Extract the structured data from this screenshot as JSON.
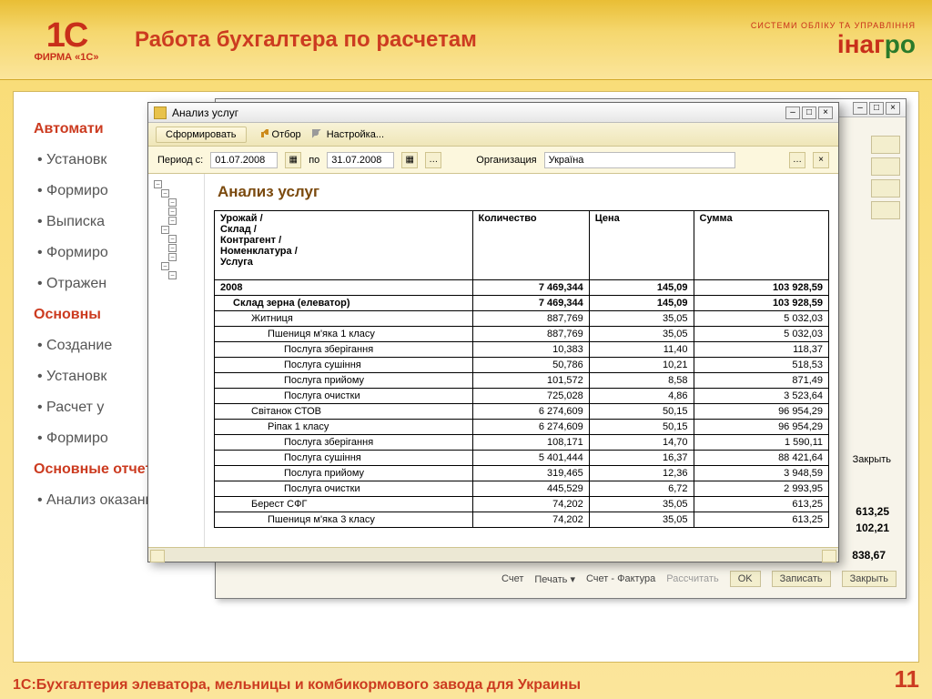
{
  "slide": {
    "logo1c_big": "1C",
    "logo1c_small": "ФИРМА «1С»",
    "title": "Работа бухгалтера по расчетам",
    "inagro_top": "СИСТЕМИ ОБЛІКУ ТА УПРАВЛІННЯ",
    "inagro_red": "інаг",
    "inagro_green": "ро",
    "sec1": "Автомати",
    "bullets1": [
      "Установк",
      "Формиро",
      "Выписка",
      "Формиро",
      "Отражен"
    ],
    "sec2": "Основны",
    "bullets2": [
      "Создание",
      "Установк",
      "Расчет у",
      "Формиро"
    ],
    "sec3": "Основные отчеты:",
    "bullets3": [
      "Анализ оказанных услуг"
    ],
    "footer": "1С:Бухгалтерия элеватора, мельницы и комбикормового завода для Украины",
    "page": "11"
  },
  "bg_window": {
    "v1": "613,25",
    "v2": "102,21",
    "sum": "838,67",
    "btns": [
      "Счет",
      "Печать ▾",
      "Счет - Фактура",
      "Рассчитать",
      "OK",
      "Записать",
      "Закрыть"
    ],
    "close": "Закрыть",
    "save": "ть"
  },
  "an": {
    "title": "Анализ услуг",
    "tb_form": "Сформировать",
    "tb_filter": "Отбор",
    "tb_settings": "Настройка...",
    "p_from_lbl": "Период с:",
    "p_from": "01.07.2008",
    "p_to_lbl": "по",
    "p_to": "31.07.2008",
    "org_lbl": "Организация",
    "org_val": "Україна",
    "rep_title": "Анализ услуг",
    "col_left": "Урожай /\nСклад /\nКонтрагент /\nНоменклатура /\nУслуга",
    "col_qty": "Количество",
    "col_price": "Цена",
    "col_sum": "Сумма",
    "rows": [
      {
        "lvl": 0,
        "n": "2008",
        "q": "7 469,344",
        "p": "145,09",
        "s": "103 928,59"
      },
      {
        "lvl": 1,
        "n": "Склад зерна (елеватор)",
        "q": "7 469,344",
        "p": "145,09",
        "s": "103 928,59"
      },
      {
        "lvl": 2,
        "n": "Житниця",
        "q": "887,769",
        "p": "35,05",
        "s": "5 032,03"
      },
      {
        "lvl": 3,
        "n": "Пшениця м'яка 1 класу",
        "q": "887,769",
        "p": "35,05",
        "s": "5 032,03"
      },
      {
        "lvl": 4,
        "n": "Послуга зберігання",
        "q": "10,383",
        "p": "11,40",
        "s": "118,37"
      },
      {
        "lvl": 4,
        "n": "Послуга сушіння",
        "q": "50,786",
        "p": "10,21",
        "s": "518,53"
      },
      {
        "lvl": 4,
        "n": "Послуга прийому",
        "q": "101,572",
        "p": "8,58",
        "s": "871,49"
      },
      {
        "lvl": 4,
        "n": "Послуга очистки",
        "q": "725,028",
        "p": "4,86",
        "s": "3 523,64"
      },
      {
        "lvl": 2,
        "n": "Світанок СТОВ",
        "q": "6 274,609",
        "p": "50,15",
        "s": "96 954,29"
      },
      {
        "lvl": 3,
        "n": "Ріпак 1 класу",
        "q": "6 274,609",
        "p": "50,15",
        "s": "96 954,29"
      },
      {
        "lvl": 4,
        "n": "Послуга зберігання",
        "q": "108,171",
        "p": "14,70",
        "s": "1 590,11"
      },
      {
        "lvl": 4,
        "n": "Послуга сушіння",
        "q": "5 401,444",
        "p": "16,37",
        "s": "88 421,64"
      },
      {
        "lvl": 4,
        "n": "Послуга прийому",
        "q": "319,465",
        "p": "12,36",
        "s": "3 948,59"
      },
      {
        "lvl": 4,
        "n": "Послуга очистки",
        "q": "445,529",
        "p": "6,72",
        "s": "2 993,95"
      },
      {
        "lvl": 2,
        "n": "Берест СФГ",
        "q": "74,202",
        "p": "35,05",
        "s": "613,25"
      },
      {
        "lvl": 3,
        "n": "Пшениця м'яка 3 класу",
        "q": "74,202",
        "p": "35,05",
        "s": "613,25"
      }
    ]
  }
}
